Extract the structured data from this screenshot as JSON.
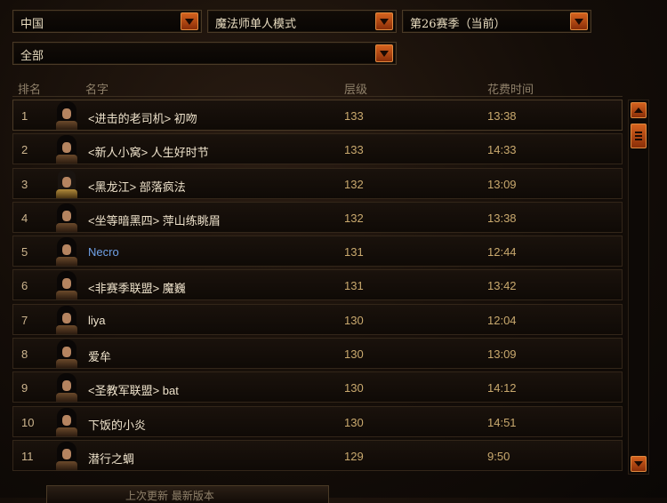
{
  "filters": {
    "region": "中国",
    "mode": "魔法师单人模式",
    "season": "第26赛季（当前）",
    "category": "全部"
  },
  "columns": {
    "rank": "排名",
    "name": "名字",
    "level": "层级",
    "time": "花费时间"
  },
  "rows": [
    {
      "rank": "1",
      "name": "<进击的老司机> 初吻",
      "level": "133",
      "time": "13:38",
      "portrait": "female"
    },
    {
      "rank": "2",
      "name": "<新人小窝> 人生好时节",
      "level": "133",
      "time": "14:33",
      "portrait": "female"
    },
    {
      "rank": "3",
      "name": "<黑龙江> 部落疯法",
      "level": "132",
      "time": "13:09",
      "portrait": "male"
    },
    {
      "rank": "4",
      "name": "<坐等暗黑四> 萍山练眺眉",
      "level": "132",
      "time": "13:38",
      "portrait": "female"
    },
    {
      "rank": "5",
      "name": "Necro",
      "level": "131",
      "time": "12:44",
      "portrait": "female",
      "link": true
    },
    {
      "rank": "6",
      "name": "<非赛季联盟> 魔巍",
      "level": "131",
      "time": "13:42",
      "portrait": "female"
    },
    {
      "rank": "7",
      "name": "liya",
      "level": "130",
      "time": "12:04",
      "portrait": "female"
    },
    {
      "rank": "8",
      "name": "爱牟",
      "level": "130",
      "time": "13:09",
      "portrait": "female"
    },
    {
      "rank": "9",
      "name": "<圣教军联盟> bat",
      "level": "130",
      "time": "14:12",
      "portrait": "female"
    },
    {
      "rank": "10",
      "name": "下饭的小炎",
      "level": "130",
      "time": "14:51",
      "portrait": "female"
    },
    {
      "rank": "11",
      "name": "潜行之蜩",
      "level": "129",
      "time": "9:50",
      "portrait": "female"
    }
  ],
  "footer": {
    "label": "上次更新  最新版本"
  },
  "colors": {
    "accent": "#c8561a",
    "link": "#6fa1e6",
    "value": "#c9a96e"
  }
}
